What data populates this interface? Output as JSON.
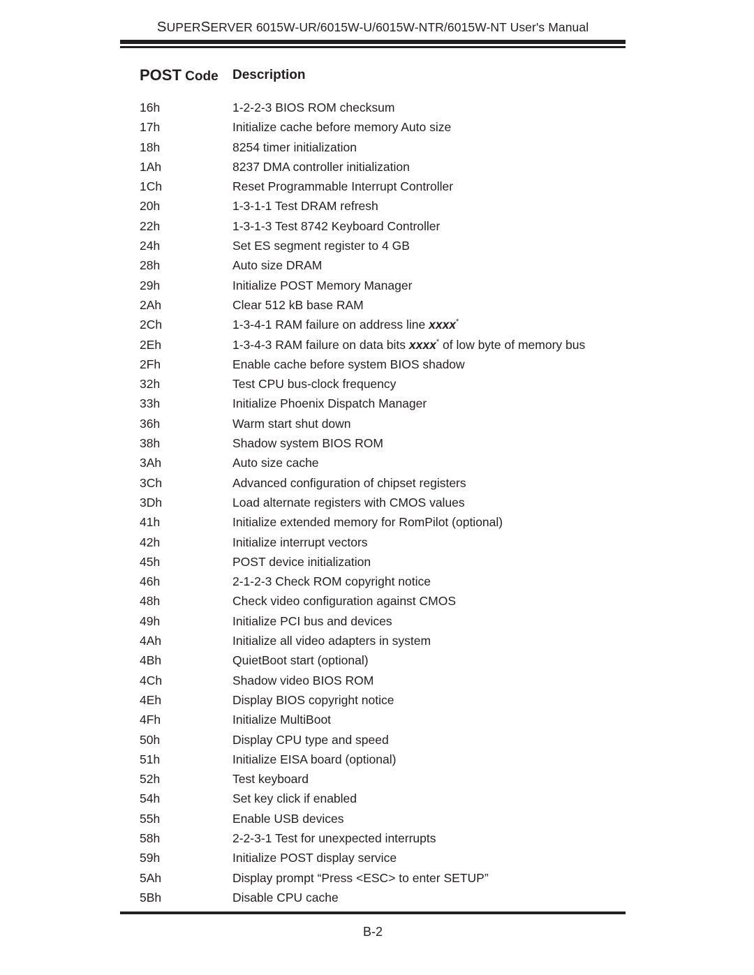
{
  "header": {
    "running_title_prefix": "S",
    "running_title_part1": "UPER",
    "running_title_s2": "S",
    "running_title_part2": "ERVER 6015W-UR/6015W-U/6015W-NTR/6015W-NT User's Manual",
    "running_title_full": "SUPERSERVER 6015W-UR/6015W-U/6015W-NTR/6015W-NT User's Manual"
  },
  "table": {
    "columns": {
      "code_head_cap": "POST",
      "code_head_rest": " Code",
      "description_head": "Description"
    },
    "rows": [
      {
        "code": "16h",
        "description": "1-2-2-3 BIOS ROM checksum"
      },
      {
        "code": "17h",
        "description": "Initialize cache before memory Auto size"
      },
      {
        "code": "18h",
        "description": "8254 timer initialization"
      },
      {
        "code": "1Ah",
        "description": "8237 DMA controller initialization"
      },
      {
        "code": "1Ch",
        "description": "Reset Programmable Interrupt Controller"
      },
      {
        "code": "20h",
        "description": "1-3-1-1 Test DRAM refresh"
      },
      {
        "code": "22h",
        "description": "1-3-1-3 Test 8742 Keyboard Controller"
      },
      {
        "code": "24h",
        "description": "Set ES segment register to 4 GB"
      },
      {
        "code": "28h",
        "description": "Auto size DRAM"
      },
      {
        "code": "29h",
        "description": "Initialize POST Memory Manager"
      },
      {
        "code": "2Ah",
        "description": "Clear 512 kB base RAM"
      },
      {
        "code": "2Ch",
        "description": "1-3-4-1 RAM failure on address line ",
        "emphasis": "xxxx",
        "note": "*",
        "description_tail": ""
      },
      {
        "code": "2Eh",
        "description": "1-3-4-3 RAM failure on data bits ",
        "emphasis": "xxxx",
        "note": "*",
        "description_tail": " of low byte of memory bus"
      },
      {
        "code": "2Fh",
        "description": "Enable cache before system BIOS shadow"
      },
      {
        "code": "32h",
        "description": "Test CPU bus-clock frequency"
      },
      {
        "code": "33h",
        "description": "Initialize Phoenix Dispatch Manager"
      },
      {
        "code": "36h",
        "description": "Warm start shut down"
      },
      {
        "code": "38h",
        "description": "Shadow system BIOS ROM"
      },
      {
        "code": "3Ah",
        "description": "Auto size cache"
      },
      {
        "code": "3Ch",
        "description": "Advanced configuration of chipset registers"
      },
      {
        "code": "3Dh",
        "description": "Load alternate registers with CMOS values"
      },
      {
        "code": "41h",
        "description": "Initialize extended memory for RomPilot (optional)"
      },
      {
        "code": "42h",
        "description": "Initialize interrupt vectors"
      },
      {
        "code": "45h",
        "description": "POST device initialization"
      },
      {
        "code": "46h",
        "description": "2-1-2-3 Check ROM copyright notice"
      },
      {
        "code": "48h",
        "description": "Check video configuration against CMOS"
      },
      {
        "code": "49h",
        "description": "Initialize PCI bus and devices"
      },
      {
        "code": "4Ah",
        "description": "Initialize all video adapters in system"
      },
      {
        "code": "4Bh",
        "description": "QuietBoot start (optional)"
      },
      {
        "code": "4Ch",
        "description": "Shadow video BIOS ROM"
      },
      {
        "code": "4Eh",
        "description": "Display BIOS copyright notice"
      },
      {
        "code": "4Fh",
        "description": "Initialize MultiBoot"
      },
      {
        "code": "50h",
        "description": "Display CPU type and speed"
      },
      {
        "code": "51h",
        "description": "Initialize EISA board (optional)"
      },
      {
        "code": "52h",
        "description": "Test keyboard"
      },
      {
        "code": "54h",
        "description": "Set key click if enabled"
      },
      {
        "code": "55h",
        "description": "Enable USB devices"
      },
      {
        "code": "58h",
        "description": "2-2-3-1 Test for unexpected interrupts"
      },
      {
        "code": "59h",
        "description": "Initialize POST display service"
      },
      {
        "code": "5Ah",
        "description": "Display prompt “Press <ESC> to enter SETUP”"
      },
      {
        "code": "5Bh",
        "description": "Disable CPU cache"
      }
    ]
  },
  "footer": {
    "page_number": "B-2"
  },
  "colors": {
    "text": "#231f20",
    "rule": "#231f20",
    "background": "#ffffff"
  }
}
